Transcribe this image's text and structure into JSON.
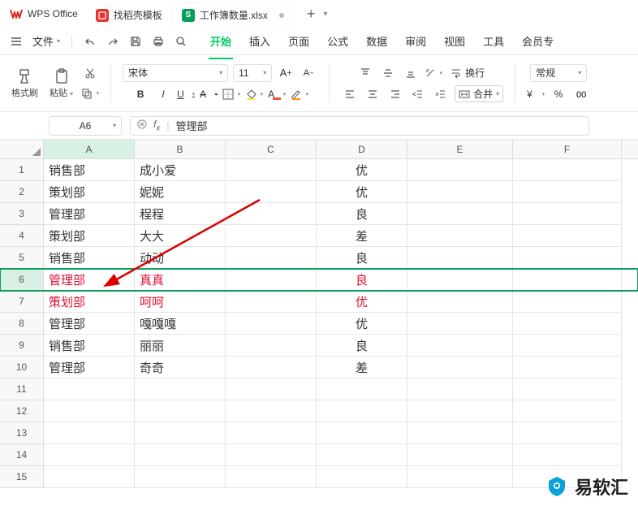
{
  "app": {
    "name": "WPS Office"
  },
  "tabs": [
    {
      "icon": "red",
      "label": "找稻壳模板",
      "active": false
    },
    {
      "icon": "green",
      "glyph": "S",
      "label": "工作簿数量.xlsx",
      "active": true
    }
  ],
  "menu": {
    "file": "文件",
    "items": [
      "开始",
      "插入",
      "页面",
      "公式",
      "数据",
      "审阅",
      "视图",
      "工具",
      "会员专"
    ]
  },
  "ribbon": {
    "formatBrush": "格式刷",
    "paste": "粘贴",
    "font": "宋体",
    "fontSize": "11",
    "wrap": "换行",
    "merge": "合并",
    "numFmt": "常规",
    "currency": "¥",
    "percent": "%"
  },
  "formula": {
    "cellRef": "A6",
    "value": "管理部"
  },
  "columns": [
    "A",
    "B",
    "C",
    "D",
    "E",
    "F"
  ],
  "rows": [
    {
      "n": 1,
      "A": "销售部",
      "B": "成小爱",
      "C": "",
      "D": "优"
    },
    {
      "n": 2,
      "A": "策划部",
      "B": "妮妮",
      "C": "",
      "D": "优"
    },
    {
      "n": 3,
      "A": "管理部",
      "B": "程程",
      "C": "",
      "D": "良"
    },
    {
      "n": 4,
      "A": "策划部",
      "B": "大大",
      "C": "",
      "D": "差"
    },
    {
      "n": 5,
      "A": "销售部",
      "B": "动动",
      "C": "",
      "D": "良"
    },
    {
      "n": 6,
      "A": "管理部",
      "B": "真真",
      "C": "",
      "D": "良"
    },
    {
      "n": 7,
      "A": "策划部",
      "B": "呵呵",
      "C": "",
      "D": "优"
    },
    {
      "n": 8,
      "A": "管理部",
      "B": "嘎嘎嘎",
      "C": "",
      "D": "优"
    },
    {
      "n": 9,
      "A": "销售部",
      "B": "丽丽",
      "C": "",
      "D": "良"
    },
    {
      "n": 10,
      "A": "管理部",
      "B": "奇奇",
      "C": "",
      "D": "差"
    },
    {
      "n": 11,
      "A": "",
      "B": "",
      "C": "",
      "D": ""
    },
    {
      "n": 12,
      "A": "",
      "B": "",
      "C": "",
      "D": ""
    },
    {
      "n": 13,
      "A": "",
      "B": "",
      "C": "",
      "D": ""
    },
    {
      "n": 14,
      "A": "",
      "B": "",
      "C": "",
      "D": ""
    },
    {
      "n": 15,
      "A": "",
      "B": "",
      "C": "",
      "D": ""
    }
  ],
  "selectedRow": 6,
  "watermark": "易软汇"
}
